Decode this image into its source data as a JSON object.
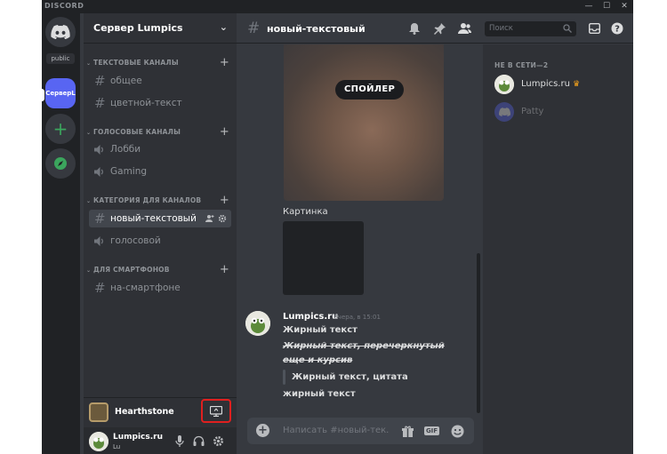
{
  "window": {
    "brand": "DISCORD",
    "controls": [
      "—",
      "☐",
      "✕"
    ]
  },
  "guilds": {
    "home_icon": "discord-logo-icon",
    "public_label": "public",
    "active_server_label": "СерверL",
    "add_icon": "plus-icon",
    "explore_icon": "compass-icon"
  },
  "server": {
    "name": "Сервер Lumpics"
  },
  "channels": {
    "categories": [
      {
        "name": "ТЕКСТОВЫЕ КАНАЛЫ",
        "items": [
          {
            "name": "общее",
            "type": "text"
          },
          {
            "name": "цветной-текст",
            "type": "text"
          }
        ]
      },
      {
        "name": "ГОЛОСОВЫЕ КАНАЛЫ",
        "items": [
          {
            "name": "Лобби",
            "type": "voice"
          },
          {
            "name": "Gaming",
            "type": "voice"
          }
        ]
      },
      {
        "name": "КАТЕГОРИЯ ДЛЯ КАНАЛОВ",
        "items": [
          {
            "name": "новый-текстовый",
            "type": "text",
            "active": true
          },
          {
            "name": "голосовой",
            "type": "voice"
          }
        ]
      },
      {
        "name": "ДЛЯ СМАРТФОНОВ",
        "items": [
          {
            "name": "на-смартфоне",
            "type": "text"
          }
        ]
      }
    ]
  },
  "activity": {
    "game": "Hearthstone"
  },
  "user": {
    "name": "Lumpics.ru",
    "tag": "Lu"
  },
  "chat": {
    "channel": "новый-текстовый",
    "search_placeholder": "Поиск",
    "spoiler_label": "СПОЙЛЕР",
    "image_caption": "Картинка",
    "message": {
      "author": "Lumpics.ru",
      "time": "Вчера, в 15:01",
      "line1": "Жирный текст",
      "line2": "Жирный текст, перечеркнутый еще и курсив",
      "quote": "Жирный текст, цитата",
      "line4": "жирный текст"
    },
    "composer_placeholder": "Написать #новый-тек...",
    "gif_label": "GIF"
  },
  "members": {
    "category": "НЕ В СЕТИ—2",
    "list": [
      {
        "name": "Lumpics.ru",
        "crown": true
      },
      {
        "name": "Patty",
        "bot": true
      }
    ]
  },
  "colors": {
    "accent": "#5865f2",
    "highlight": "#e0201f",
    "online": "#3ba55d"
  }
}
